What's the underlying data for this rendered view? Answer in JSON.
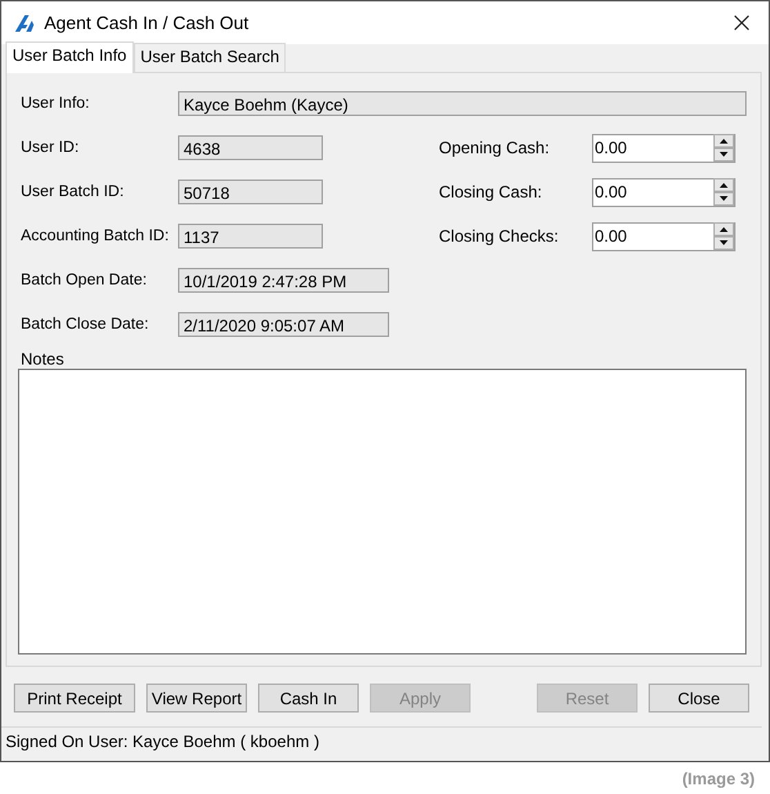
{
  "window": {
    "title": "Agent Cash In / Cash Out"
  },
  "tabs": [
    {
      "label": "User Batch Info",
      "selected": true
    },
    {
      "label": "User Batch Search",
      "selected": false
    }
  ],
  "user_info": {
    "label": "User Info:",
    "value": "Kayce Boehm (Kayce)"
  },
  "left_fields": [
    {
      "label": "User ID:",
      "value": "4638"
    },
    {
      "label": "User Batch ID:",
      "value": "50718"
    },
    {
      "label": "Accounting Batch ID:",
      "value": "1137"
    },
    {
      "label": "Batch Open Date:",
      "value": "10/1/2019 2:47:28 PM"
    },
    {
      "label": "Batch Close Date:",
      "value": "2/11/2020 9:05:07 AM"
    }
  ],
  "right_fields": [
    {
      "label": "Opening Cash:",
      "value": "0.00"
    },
    {
      "label": "Closing Cash:",
      "value": "0.00"
    },
    {
      "label": "Closing Checks:",
      "value": "0.00"
    }
  ],
  "notes": {
    "label": "Notes"
  },
  "left_buttons": [
    {
      "label": "Print Receipt",
      "disabled": false
    },
    {
      "label": "View Report",
      "disabled": false
    },
    {
      "label": "Cash In",
      "disabled": false
    },
    {
      "label": "Apply",
      "disabled": true
    }
  ],
  "right_buttons": [
    {
      "label": "Reset",
      "disabled": true
    },
    {
      "label": "Close",
      "disabled": false
    }
  ],
  "status_bar": "Signed On User: Kayce Boehm ( kboehm )",
  "caption": "(Image 3)"
}
